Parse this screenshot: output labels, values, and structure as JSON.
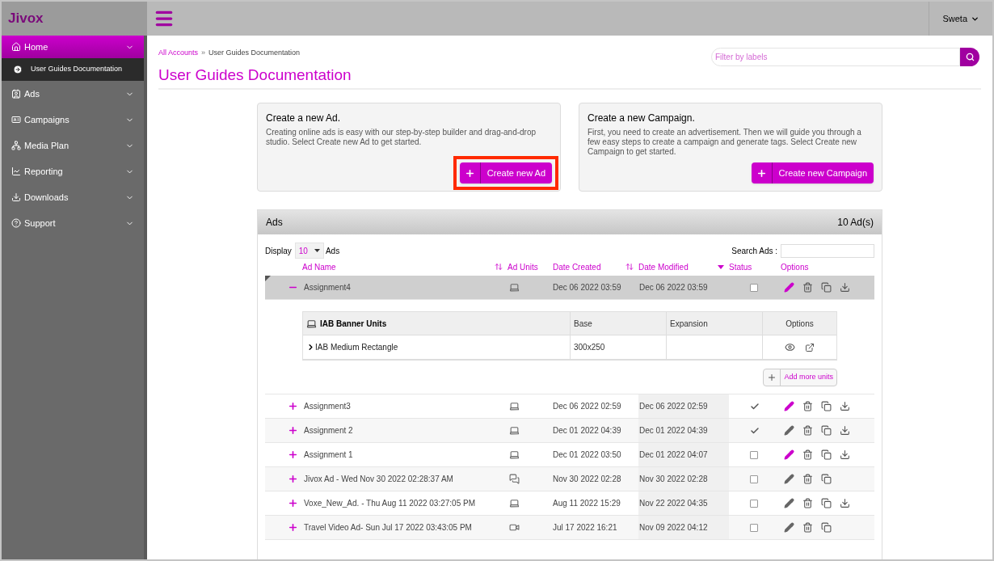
{
  "app": {
    "logo": "Jivox",
    "user": "Sweta"
  },
  "sidebar": {
    "items": [
      {
        "label": "Home",
        "kind": "home",
        "selected": true,
        "children": [
          {
            "label": "User Guides Documentation",
            "selected": true
          }
        ]
      },
      {
        "label": "Ads",
        "kind": "ads",
        "selected": false
      },
      {
        "label": "Campaigns",
        "kind": "campaigns",
        "selected": false
      },
      {
        "label": "Media Plan",
        "kind": "mediaplan",
        "selected": false
      },
      {
        "label": "Reporting",
        "kind": "reporting",
        "selected": false
      },
      {
        "label": "Downloads",
        "kind": "downloads",
        "selected": false
      },
      {
        "label": "Support",
        "kind": "support",
        "selected": false
      }
    ]
  },
  "breadcrumb": {
    "separator": "»",
    "items": [
      "All Accounts",
      "User Guides Documentation"
    ]
  },
  "page_title": "User Guides Documentation",
  "filter": {
    "placeholder": "Filter by labels"
  },
  "cards": [
    {
      "title": "Create a new Ad.",
      "text": "Creating online ads is easy with our step-by-step builder and drag-and-drop studio. Select Create new Ad to get started.",
      "button": {
        "label": "Create new Ad",
        "highlighted": true
      }
    },
    {
      "title": "Create a new Campaign.",
      "text": "First, you need to create an advertisement. Then we will guide you through a few easy steps to create a campaign and generate tags. Select Create new Campaign to get started.",
      "button": {
        "label": "Create new Campaign",
        "highlighted": false
      }
    }
  ],
  "ads": {
    "title": "Ads",
    "count": "10 Ad(s)",
    "display": {
      "label": "Display",
      "value": "10",
      "suffix": "Ads"
    },
    "search": {
      "label": "Search Ads :"
    },
    "columns": [
      {
        "label": "Ad Name",
        "kind": "sortable"
      },
      {
        "label": "Ad Units",
        "kind": "plain"
      },
      {
        "label": "Date Created",
        "kind": "sortable"
      },
      {
        "label": "Date Modified",
        "kind": "sorted"
      },
      {
        "label": "Status",
        "kind": "plain"
      },
      {
        "label": "Options",
        "kind": "plain"
      }
    ],
    "rows": [
      {
        "name": "Assignment4",
        "kind": "laptop",
        "created": "Dec 06 2022 03:59",
        "modified": "Dec 06 2022 03:59",
        "checked": false,
        "edit_highlighted": true,
        "downloadable": true,
        "expanded": true,
        "selected": true,
        "detail": {
          "heading": "IAB Banner Units",
          "columns": [
            "Base",
            "Expansion",
            "Options"
          ],
          "rows": [
            {
              "name": "IAB Medium Rectangle",
              "base": "300x250"
            }
          ],
          "add_button": "Add more units"
        }
      },
      {
        "name": "Assignment3",
        "kind": "laptop",
        "created": "Dec 06 2022 02:59",
        "modified": "Dec 06 2022 02:59",
        "checked": true,
        "edit_highlighted": true,
        "downloadable": true,
        "expanded": false,
        "selected": false
      },
      {
        "name": "Assignment 2",
        "kind": "laptop",
        "created": "Dec 01 2022 04:39",
        "modified": "Dec 01 2022 04:39",
        "checked": true,
        "edit_highlighted": false,
        "downloadable": true,
        "expanded": false,
        "selected": false
      },
      {
        "name": "Assignment 1",
        "kind": "laptop",
        "created": "Dec 01 2022 03:50",
        "modified": "Dec 01 2022 04:07",
        "checked": false,
        "edit_highlighted": true,
        "downloadable": true,
        "expanded": false,
        "selected": false
      },
      {
        "name": "Jivox Ad - Wed Nov 30 2022 02:28:37 AM",
        "kind": "chat",
        "created": "Nov 30 2022 02:28",
        "modified": "Nov 30 2022 02:28",
        "checked": false,
        "edit_highlighted": false,
        "downloadable": false,
        "expanded": false,
        "selected": false
      },
      {
        "name": "Voxe_New_Ad. - Thu Aug 11 2022 03:27:05 PM",
        "kind": "laptop",
        "created": "Aug 11 2022 15:29",
        "modified": "Nov 22 2022 04:35",
        "checked": false,
        "edit_highlighted": false,
        "downloadable": true,
        "expanded": false,
        "selected": false
      },
      {
        "name": "Travel Video Ad- Sun Jul 17 2022 03:43:05 PM",
        "kind": "video",
        "created": "Jul 17 2022 16:21",
        "modified": "Nov 09 2022 04:12",
        "checked": false,
        "edit_highlighted": false,
        "downloadable": false,
        "expanded": false,
        "selected": false
      }
    ]
  }
}
